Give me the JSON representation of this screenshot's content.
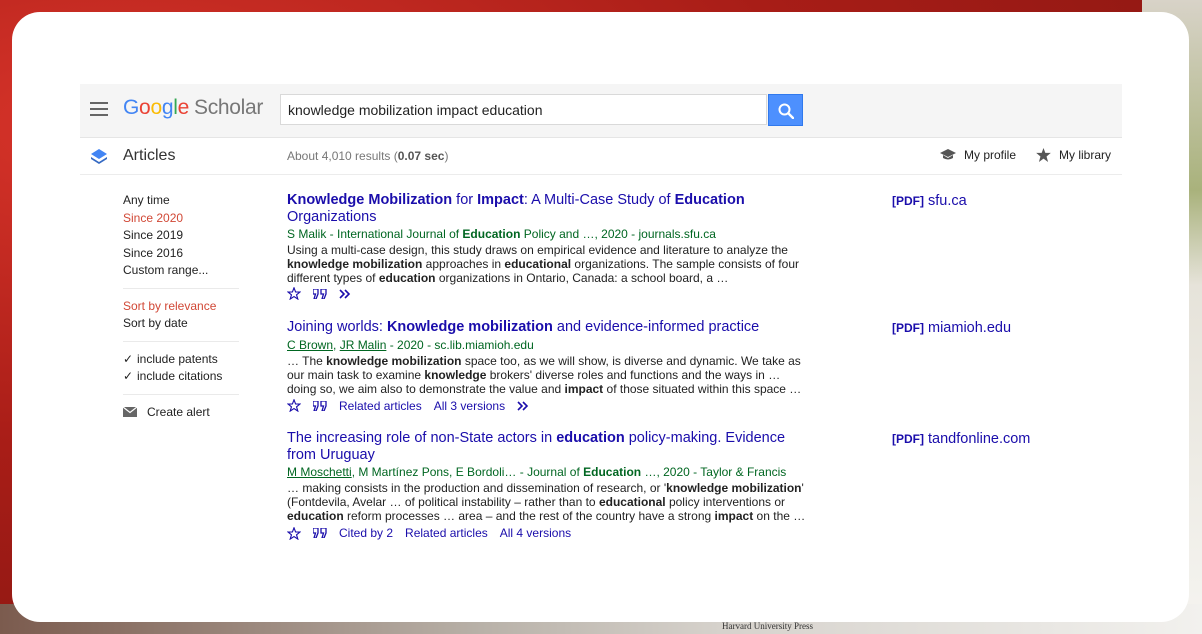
{
  "header": {
    "logo_google": [
      "G",
      "o",
      "o",
      "g",
      "l",
      "e"
    ],
    "logo_scholar": "Scholar",
    "search_value": "knowledge mobilization impact education"
  },
  "subbar": {
    "articles_label": "Articles",
    "results_prefix": "About 4,010 results (",
    "results_time": "0.07 sec",
    "results_suffix": ")",
    "my_profile": "My profile",
    "my_library": "My library"
  },
  "sidebar": {
    "time": [
      "Any time",
      "Since 2020",
      "Since 2019",
      "Since 2016",
      "Custom range..."
    ],
    "sort": [
      "Sort by relevance",
      "Sort by date"
    ],
    "include": [
      "include patents",
      "include citations"
    ],
    "create_alert": "Create alert",
    "selected_color": "#d14836"
  },
  "results": [
    {
      "title_parts": [
        [
          "Knowledge Mobilization",
          true
        ],
        [
          " for ",
          false
        ],
        [
          "Impact",
          true
        ],
        [
          ": A Multi-Case Study of ",
          false
        ],
        [
          "Education",
          true
        ],
        [
          " Organizations",
          false
        ]
      ],
      "authors_parts": [
        [
          "S Malik",
          false
        ],
        [
          " - International Journal of ",
          false
        ],
        [
          "Education",
          true
        ],
        [
          " Policy and …, 2020 - journals.sfu.ca",
          false
        ]
      ],
      "snippet_parts": [
        [
          "Using a multi-case design, this study draws on empirical evidence and literature to analyze the ",
          false
        ],
        [
          "knowledge mobilization",
          true
        ],
        [
          " approaches in ",
          false
        ],
        [
          "educational",
          true
        ],
        [
          " organizations. The sample consists of four different types of ",
          false
        ],
        [
          "education",
          true
        ],
        [
          " organizations in Ontario, Canada: a school board, a …",
          false
        ]
      ],
      "links": [],
      "pdf_tag": "[PDF]",
      "pdf_source": "sfu.ca"
    },
    {
      "title_parts": [
        [
          "Joining worlds: ",
          false
        ],
        [
          "Knowledge mobilization",
          true
        ],
        [
          " and evidence-informed practice",
          false
        ]
      ],
      "authors_parts": [
        [
          "C Brown",
          "u"
        ],
        [
          ", ",
          false
        ],
        [
          "JR Malin",
          "u"
        ],
        [
          " - 2020 - sc.lib.miamioh.edu",
          false
        ]
      ],
      "snippet_parts": [
        [
          "… The ",
          false
        ],
        [
          "knowledge mobilization",
          true
        ],
        [
          " space too, as we will show, is diverse and dynamic. We take as our main task to examine ",
          false
        ],
        [
          "knowledge",
          true
        ],
        [
          " brokers' diverse roles and functions and the ways in … doing so, we aim also to demonstrate the value and ",
          false
        ],
        [
          "impact",
          true
        ],
        [
          " of those situated within this space …",
          false
        ]
      ],
      "links": [
        "Related articles",
        "All 3 versions"
      ],
      "pdf_tag": "[PDF]",
      "pdf_source": "miamioh.edu"
    },
    {
      "title_parts": [
        [
          "The increasing role of non-State actors in ",
          false
        ],
        [
          "education",
          true
        ],
        [
          " policy-making. Evidence from Uruguay",
          false
        ]
      ],
      "authors_parts": [
        [
          "M Moschetti",
          "u"
        ],
        [
          ", M Martínez Pons, E Bordoli… - Journal of ",
          false
        ],
        [
          "Education",
          true
        ],
        [
          " …, 2020 - Taylor & Francis",
          false
        ]
      ],
      "snippet_parts": [
        [
          "… making consists in the production and dissemination of research, or '",
          false
        ],
        [
          "knowledge mobilization",
          true
        ],
        [
          "' (Fontdevila, Avelar … of political instability – rather than to ",
          false
        ],
        [
          "educational",
          true
        ],
        [
          " policy interventions or ",
          false
        ],
        [
          "education",
          true
        ],
        [
          " reform processes … area – and the rest of the country have a strong ",
          false
        ],
        [
          "impact",
          true
        ],
        [
          " on the …",
          false
        ]
      ],
      "links": [
        "Cited by 2",
        "Related articles",
        "All 4 versions"
      ],
      "pdf_tag": "[PDF]",
      "pdf_source": "tandfonline.com"
    }
  ],
  "background": {
    "footer_text": "Harvard University Press"
  },
  "colors": {
    "link": "#1a0dab",
    "green": "#006621",
    "search_button": "#4d90fe"
  }
}
